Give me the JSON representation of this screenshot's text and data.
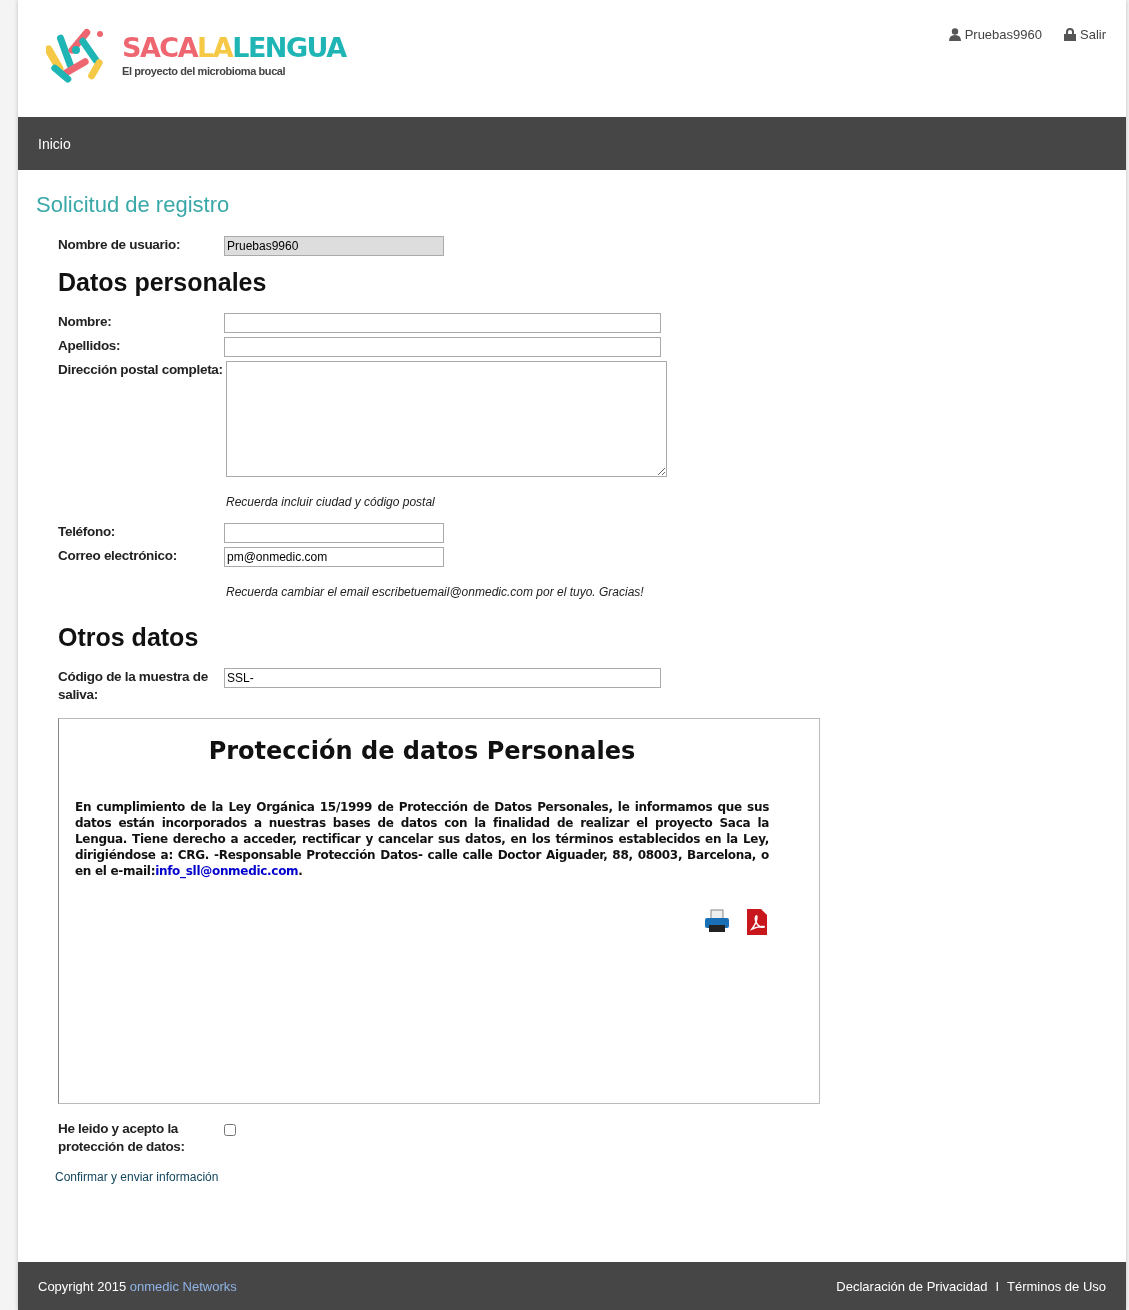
{
  "header": {
    "logo": {
      "parts": [
        {
          "text": "SACA",
          "color": "#ee6670"
        },
        {
          "text": "LA",
          "color": "#f5c945"
        },
        {
          "text": "LENGUA",
          "color": "#1fb5b5"
        }
      ],
      "tagline": "El proyecto del microbioma bucal"
    },
    "user": "Pruebas9960",
    "logout": "Salir"
  },
  "nav": [
    {
      "label": "Inicio"
    }
  ],
  "title": "Solicitud de registro",
  "username": {
    "label": "Nombre de usuario:",
    "value": "Pruebas9960"
  },
  "personal": {
    "heading": "Datos personales",
    "fields": [
      {
        "kind": "long",
        "label": "Nombre:"
      },
      {
        "kind": "long",
        "label": "Apellidos:"
      },
      {
        "kind": "textarea",
        "label": "Dirección postal completa:",
        "hint": "Recuerda incluir ciudad y código postal"
      },
      {
        "kind": "short",
        "label": "Teléfono:"
      },
      {
        "kind": "short",
        "label": "Correo electrónico:",
        "value": "pm@onmedic.com",
        "hint": "Recuerda cambiar el email escribetuemail@onmedic.com por el tuyo. Gracias!"
      }
    ]
  },
  "other": {
    "heading": "Otros datos",
    "fields": [
      {
        "kind": "long",
        "label": "Código de la muestra de saliva:",
        "value": "SSL-"
      }
    ]
  },
  "privacy": {
    "heading": "Protección de datos Personales",
    "text": "En cumplimiento de la Ley Orgánica 15/1999 de Protección de Datos Personales, le informamos que sus datos están incorporados a nuestras bases de datos con la finalidad de realizar el proyecto Saca la Lengua. Tiene derecho a acceder, rectificar y cancelar sus datos, en los términos establecidos en la Ley, dirigiéndose a: CRG. -Responsable Protección Datos- calle calle Doctor Aiguader, 88, 08003, Barcelona, o en el e-mail:",
    "link": "info_sll@onmedic.com",
    "after": "."
  },
  "accept": {
    "label": "He leido y acepto la protección de datos:",
    "checked": false
  },
  "submit": "Confirmar y enviar información",
  "footer": {
    "copyright": "Copyright 2015",
    "company": "onmedic Networks",
    "links": [
      {
        "label": "Declaración de Privacidad"
      },
      {
        "label": "Términos de Uso"
      }
    ],
    "separator": "I"
  }
}
